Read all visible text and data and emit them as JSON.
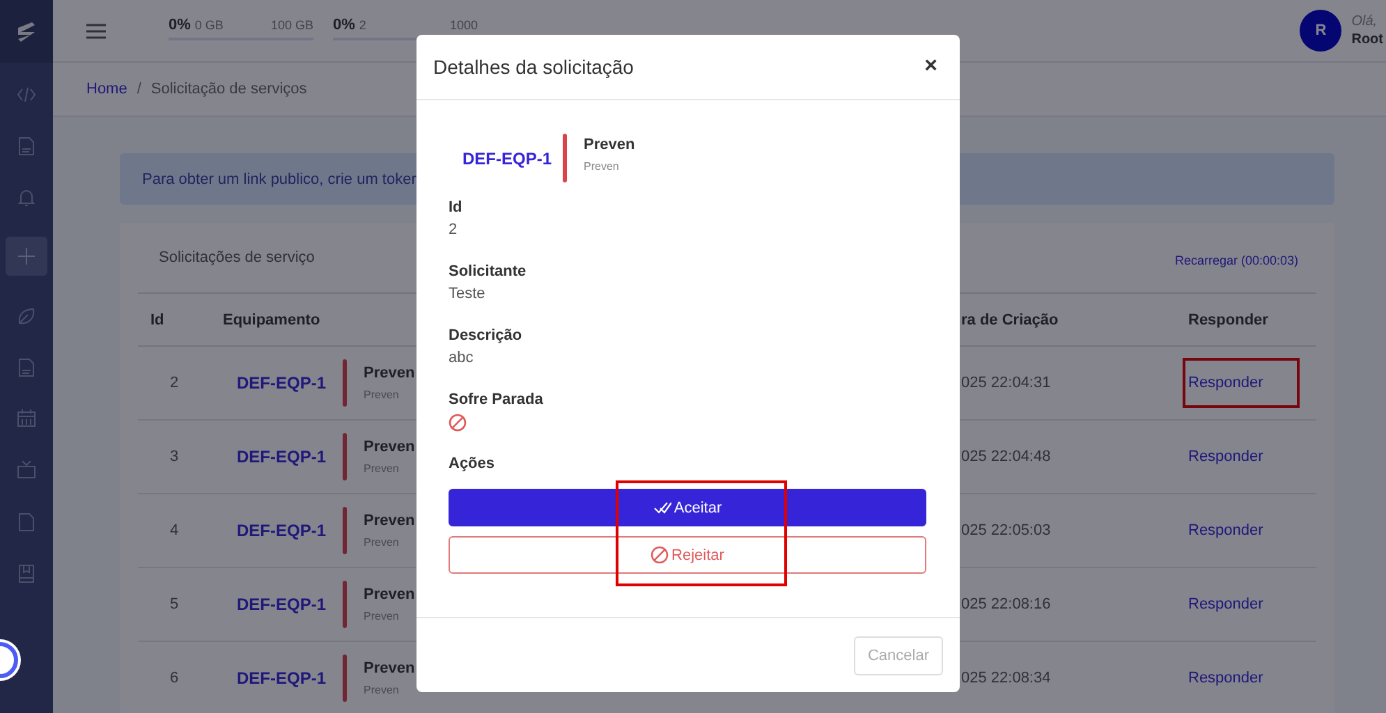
{
  "topbar": {
    "meters": [
      {
        "percent": "0%",
        "used": "0 GB",
        "total": "100 GB",
        "level": 0
      },
      {
        "percent": "0%",
        "used": "2",
        "total": "1000",
        "level": 0
      }
    ],
    "user": {
      "initial": "R",
      "greeting": "Olá,",
      "name": "Root"
    }
  },
  "breadcrumb_separator": "/",
  "breadcrumb": [
    {
      "label": "Home",
      "current": false
    },
    {
      "label": "Solicitação de serviços",
      "current": true
    }
  ],
  "alert": {
    "text": "Para obter um link publico, crie um toker"
  },
  "card": {
    "title": "Solicitações de serviço",
    "reload": "Recarregar (00:00:03)"
  },
  "table": {
    "columns": [
      "Id",
      "Equipamento",
      "ra de Criação",
      "Responder"
    ],
    "rows": [
      {
        "id": "2",
        "equipment": {
          "code": "DEF-EQP-1",
          "title": "Preven",
          "subtitle": "Preven"
        },
        "created": "025 22:04:31",
        "action": "Responder",
        "highlighted": true
      },
      {
        "id": "3",
        "equipment": {
          "code": "DEF-EQP-1",
          "title": "Preven",
          "subtitle": "Preven"
        },
        "created": "025 22:04:48",
        "action": "Responder",
        "highlighted": false
      },
      {
        "id": "4",
        "equipment": {
          "code": "DEF-EQP-1",
          "title": "Preven",
          "subtitle": "Preven"
        },
        "created": "025 22:05:03",
        "action": "Responder",
        "highlighted": false
      },
      {
        "id": "5",
        "equipment": {
          "code": "DEF-EQP-1",
          "title": "Preven",
          "subtitle": "Preven"
        },
        "created": "025 22:08:16",
        "action": "Responder",
        "highlighted": false
      },
      {
        "id": "6",
        "equipment": {
          "code": "DEF-EQP-1",
          "title": "Preven",
          "subtitle": "Preven"
        },
        "created": "025 22:08:34",
        "action": "Responder",
        "highlighted": false
      }
    ]
  },
  "modal": {
    "title": "Detalhes da solicitação",
    "close": "×",
    "equipment": {
      "code": "DEF-EQP-1",
      "title": "Preven",
      "subtitle": "Preven"
    },
    "fields": [
      {
        "label": "Id",
        "kind": "text",
        "value": "2"
      },
      {
        "label": "Solicitante",
        "kind": "text",
        "value": "Teste"
      },
      {
        "label": "Descrição",
        "kind": "text",
        "value": "abc"
      },
      {
        "label": "Sofre Parada",
        "kind": "boolean",
        "value": false
      },
      {
        "label": "Ações",
        "kind": "heading"
      }
    ],
    "buttons": [
      {
        "label": "Aceitar",
        "kind": "accept"
      },
      {
        "label": "Rejeitar",
        "kind": "reject"
      }
    ],
    "actions_highlighted": true,
    "cancel": {
      "label": "Cancelar",
      "disabled": true
    }
  }
}
